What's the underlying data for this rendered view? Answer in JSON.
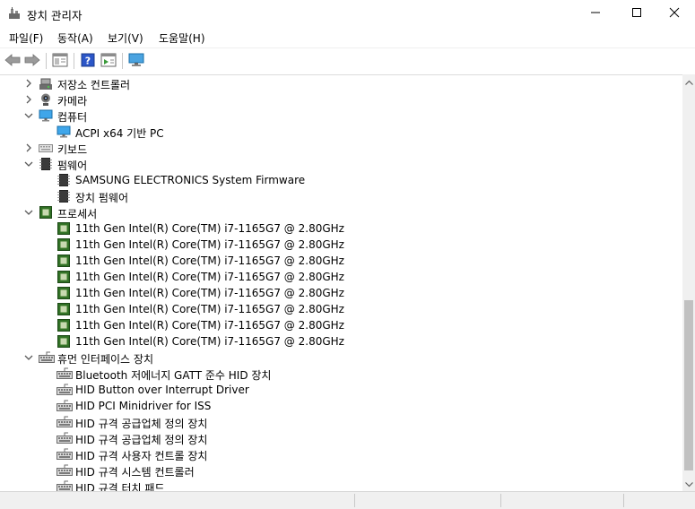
{
  "window": {
    "title": "장치 관리자",
    "controls": [
      "minimize-icon",
      "maximize-icon",
      "close-icon"
    ]
  },
  "menu": {
    "items": [
      "파일(F)",
      "동작(A)",
      "보기(V)",
      "도움말(H)"
    ]
  },
  "toolbar": {
    "buttons": [
      "back-arrow-icon",
      "forward-arrow-icon",
      "properties-panel-icon",
      "help-icon",
      "action-pane-icon",
      "monitor-icon"
    ]
  },
  "tree": {
    "nodes": [
      {
        "label": "저장소 컨트롤러",
        "level": 0,
        "state": "collapsed",
        "icon": "storage-controller-icon"
      },
      {
        "label": "카메라",
        "level": 0,
        "state": "collapsed",
        "icon": "camera-icon"
      },
      {
        "label": "컴퓨터",
        "level": 0,
        "state": "expanded",
        "icon": "computer-icon"
      },
      {
        "label": "ACPI x64 기반 PC",
        "level": 1,
        "state": "leaf",
        "icon": "computer-icon"
      },
      {
        "label": "키보드",
        "level": 0,
        "state": "collapsed",
        "icon": "keyboard-icon"
      },
      {
        "label": "펌웨어",
        "level": 0,
        "state": "expanded",
        "icon": "firmware-chip-icon"
      },
      {
        "label": "SAMSUNG ELECTRONICS System Firmware",
        "level": 1,
        "state": "leaf",
        "icon": "firmware-chip-icon"
      },
      {
        "label": "장치 펌웨어",
        "level": 1,
        "state": "leaf",
        "icon": "firmware-chip-icon"
      },
      {
        "label": "프로세서",
        "level": 0,
        "state": "expanded",
        "icon": "processor-icon"
      },
      {
        "label": "11th Gen Intel(R) Core(TM) i7-1165G7 @ 2.80GHz",
        "level": 1,
        "state": "leaf",
        "icon": "processor-icon"
      },
      {
        "label": "11th Gen Intel(R) Core(TM) i7-1165G7 @ 2.80GHz",
        "level": 1,
        "state": "leaf",
        "icon": "processor-icon"
      },
      {
        "label": "11th Gen Intel(R) Core(TM) i7-1165G7 @ 2.80GHz",
        "level": 1,
        "state": "leaf",
        "icon": "processor-icon"
      },
      {
        "label": "11th Gen Intel(R) Core(TM) i7-1165G7 @ 2.80GHz",
        "level": 1,
        "state": "leaf",
        "icon": "processor-icon"
      },
      {
        "label": "11th Gen Intel(R) Core(TM) i7-1165G7 @ 2.80GHz",
        "level": 1,
        "state": "leaf",
        "icon": "processor-icon"
      },
      {
        "label": "11th Gen Intel(R) Core(TM) i7-1165G7 @ 2.80GHz",
        "level": 1,
        "state": "leaf",
        "icon": "processor-icon"
      },
      {
        "label": "11th Gen Intel(R) Core(TM) i7-1165G7 @ 2.80GHz",
        "level": 1,
        "state": "leaf",
        "icon": "processor-icon"
      },
      {
        "label": "11th Gen Intel(R) Core(TM) i7-1165G7 @ 2.80GHz",
        "level": 1,
        "state": "leaf",
        "icon": "processor-icon"
      },
      {
        "label": "휴먼 인터페이스 장치",
        "level": 0,
        "state": "expanded",
        "icon": "hid-device-icon"
      },
      {
        "label": "Bluetooth 저에너지 GATT 준수 HID 장치",
        "level": 1,
        "state": "leaf",
        "icon": "hid-device-icon"
      },
      {
        "label": "HID Button over Interrupt Driver",
        "level": 1,
        "state": "leaf",
        "icon": "hid-device-icon"
      },
      {
        "label": "HID PCI Minidriver for ISS",
        "level": 1,
        "state": "leaf",
        "icon": "hid-device-icon"
      },
      {
        "label": "HID 규격 공급업체 정의 장치",
        "level": 1,
        "state": "leaf",
        "icon": "hid-device-icon"
      },
      {
        "label": "HID 규격 공급업체 정의 장치",
        "level": 1,
        "state": "leaf",
        "icon": "hid-device-icon"
      },
      {
        "label": "HID 규격 사용자 컨트롤 장치",
        "level": 1,
        "state": "leaf",
        "icon": "hid-device-icon"
      },
      {
        "label": "HID 규격 시스템 컨트롤러",
        "level": 1,
        "state": "leaf",
        "icon": "hid-device-icon"
      },
      {
        "label": "HID 규격 터치 패드",
        "level": 1,
        "state": "leaf",
        "icon": "hid-device-icon"
      }
    ]
  },
  "colors": {
    "accent": "#0078d7",
    "processor_green": "#3b7a2a",
    "chevron": "#5a5a5a"
  }
}
